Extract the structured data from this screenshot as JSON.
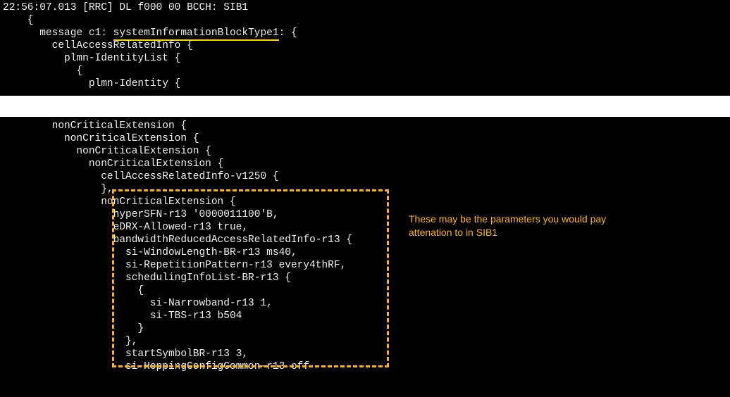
{
  "header": {
    "timestamp": "22:56:07.013",
    "tag": "[RRC]",
    "dir": "DL",
    "addr": "f000",
    "val": "00",
    "ch": "BCCH:",
    "msg": "SIB1"
  },
  "top": {
    "brace1": "    {",
    "msg_prefix": "      message c1: ",
    "msg_name": "systemInformationBlockType1",
    "msg_suffix": ": {",
    "car": "        cellAccessRelatedInfo {",
    "pil": "          plmn-IdentityList {",
    "brace2": "            {",
    "pi": "              plmn-Identity {"
  },
  "mid": {
    "n1": "        nonCriticalExtension {",
    "n2": "          nonCriticalExtension {",
    "n3": "            nonCriticalExtension {",
    "n4": "              nonCriticalExtension {",
    "car": "                cellAccessRelatedInfo-v1250 {",
    "close1": "                },",
    "n5": "                nonCriticalExtension {",
    "hsfn": "                  hyperSFN-r13 '0000011100'B,",
    "edrx": "                  eDRX-Allowed-r13 true,",
    "bwr": "                  bandwidthReducedAccessRelatedInfo-r13 {",
    "siw": "                    si-WindowLength-BR-r13 ms40,",
    "sirp": "                    si-RepetitionPattern-r13 every4thRF,",
    "sil": "                    schedulingInfoList-BR-r13 {",
    "brace3": "                      {",
    "sinb": "                        si-Narrowband-r13 1,",
    "sitbs": "                        si-TBS-r13 b504",
    "close2": "                      }",
    "close3": "                    },",
    "ssb": "                    startSymbolBR-r13 3,",
    "sihc": "                    si-HoppingConfigCommon-r13 off"
  },
  "note": {
    "line1": "These may be the parameters you would pay",
    "line2": "attenation to in SIB1"
  }
}
